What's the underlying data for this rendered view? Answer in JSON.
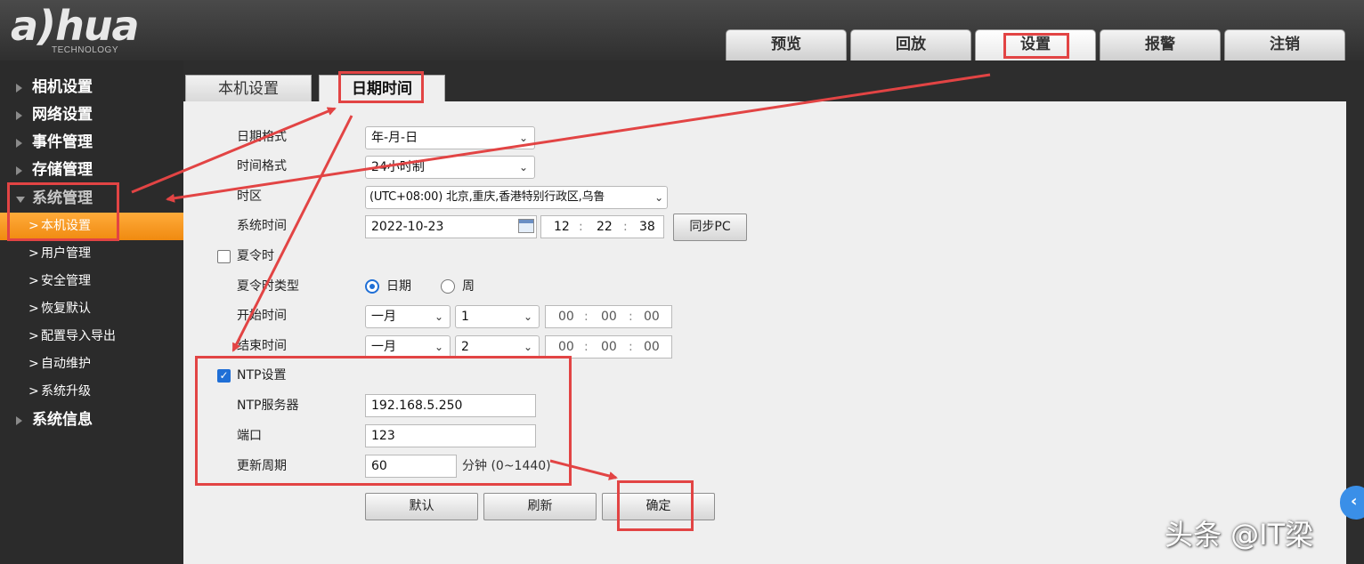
{
  "brand": {
    "logo_text": "a)hua",
    "logo_sub": "TECHNOLOGY"
  },
  "top_nav": [
    {
      "label": "预览"
    },
    {
      "label": "回放"
    },
    {
      "label": "设置"
    },
    {
      "label": "报警"
    },
    {
      "label": "注销"
    }
  ],
  "sidebar": {
    "groups": [
      {
        "label": "相机设置"
      },
      {
        "label": "网络设置"
      },
      {
        "label": "事件管理"
      },
      {
        "label": "存储管理"
      },
      {
        "label": "系统管理"
      },
      {
        "label": "系统信息"
      }
    ],
    "items": [
      {
        "label": "本机设置"
      },
      {
        "label": "用户管理"
      },
      {
        "label": "安全管理"
      },
      {
        "label": "恢复默认"
      },
      {
        "label": "配置导入导出"
      },
      {
        "label": "自动维护"
      },
      {
        "label": "系统升级"
      }
    ],
    "chevron": ">"
  },
  "tabs": [
    {
      "label": "本机设置"
    },
    {
      "label": "日期时间"
    }
  ],
  "form": {
    "date_format": {
      "label": "日期格式",
      "value": "年-月-日"
    },
    "time_format": {
      "label": "时间格式",
      "value": "24小时制"
    },
    "timezone": {
      "label": "时区",
      "value": "(UTC+08:00) 北京,重庆,香港特别行政区,乌鲁"
    },
    "system_time": {
      "label": "系统时间",
      "date": "2022-10-23",
      "hh": "12",
      "mm": "22",
      "ss": "38",
      "sync_label": "同步PC"
    },
    "dst": {
      "label": "夏令时",
      "checked": false
    },
    "dst_type": {
      "label": "夏令时类型",
      "opt_date": "日期",
      "opt_week": "周",
      "selected": "日期"
    },
    "start_time": {
      "label": "开始时间",
      "month": "一月",
      "day": "1",
      "hh": "00",
      "mm": "00",
      "ss": "00"
    },
    "end_time": {
      "label": "结束时间",
      "month": "一月",
      "day": "2",
      "hh": "00",
      "mm": "00",
      "ss": "00"
    },
    "ntp": {
      "label": "NTP设置",
      "checked": true
    },
    "ntp_server": {
      "label": "NTP服务器",
      "value": "192.168.5.250"
    },
    "port": {
      "label": "端口",
      "value": "123"
    },
    "update_period": {
      "label": "更新周期",
      "value": "60",
      "unit": "分钟 (0~1440)"
    },
    "time_separator": ":"
  },
  "buttons": {
    "default": "默认",
    "refresh": "刷新",
    "confirm": "确定"
  },
  "icons": {
    "dropdown": "chevron-down-icon",
    "calendar": "calendar-icon",
    "check": "check-icon"
  },
  "check_glyph": "✓",
  "dropdown_glyph": "⌄",
  "watermark": "头条 @IT梁",
  "float_button": "‹",
  "colors": {
    "highlight": "#e24444",
    "active_item": "#f39417",
    "checkbox": "#1f6fd6"
  }
}
